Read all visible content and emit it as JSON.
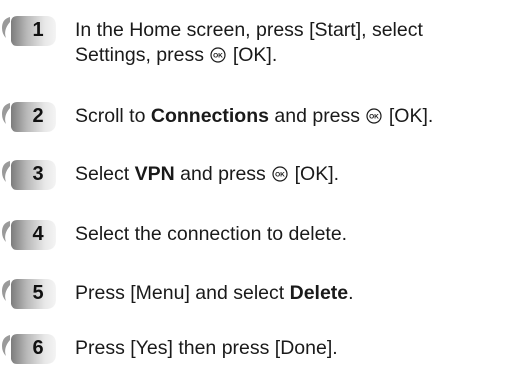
{
  "steps": [
    {
      "number": "1",
      "line1_part1": "In the Home screen, press [Start], select",
      "line2_part1": "Settings, press",
      "ok_icon": "ok-key-icon",
      "line2_part2": "[OK]."
    },
    {
      "number": "2",
      "part1": "Scroll to",
      "bold": "Connections",
      "part2": "and press",
      "ok_icon": "ok-key-icon",
      "part3": "[OK]."
    },
    {
      "number": "3",
      "part1": "Select",
      "bold": "VPN",
      "part2": "and press",
      "ok_icon": "ok-key-icon",
      "part3": "[OK]."
    },
    {
      "number": "4",
      "part1": "Select the connection to delete."
    },
    {
      "number": "5",
      "part1": "Press [Menu] and select",
      "bold": "Delete",
      "part2": "."
    },
    {
      "number": "6",
      "part1": "Press [Yes] then press [Done]."
    }
  ],
  "colors": {
    "badge_dark": "#8a8a8a",
    "badge_light": "#e6e6e6",
    "text": "#1a1a1a"
  }
}
